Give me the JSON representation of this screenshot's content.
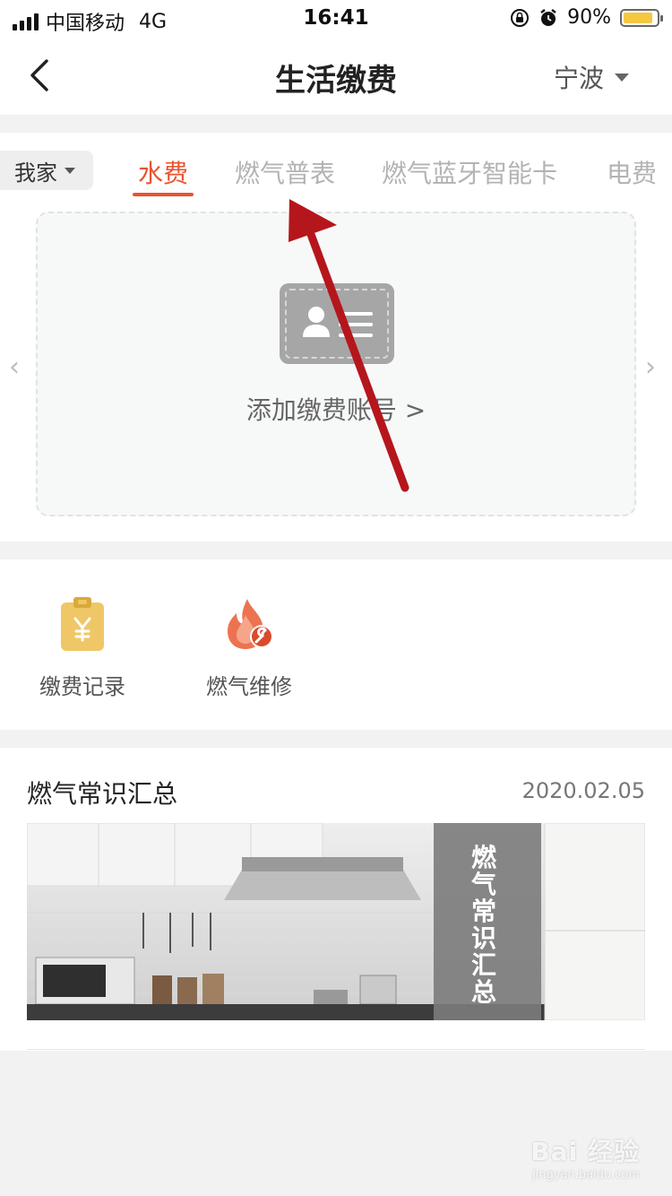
{
  "status_bar": {
    "carrier": "中国移动",
    "network": "4G",
    "time": "16:41",
    "battery": "90%",
    "battery_level": 0.9
  },
  "header": {
    "title": "生活缴费",
    "city": "宁波"
  },
  "group_selector": {
    "label": "我家"
  },
  "tabs": [
    {
      "label": "水费",
      "active": true
    },
    {
      "label": "燃气普表",
      "active": false
    },
    {
      "label": "燃气蓝牙智能卡",
      "active": false
    },
    {
      "label": "电费",
      "active": false
    }
  ],
  "add_account": {
    "label": "添加缴费账号 >"
  },
  "shortcuts": [
    {
      "label": "缴费记录",
      "icon": "payment-record-icon"
    },
    {
      "label": "燃气维修",
      "icon": "gas-repair-icon"
    }
  ],
  "article": {
    "title": "燃气常识汇总",
    "date": "2020.02.05",
    "image_caption": "燃气常识汇总"
  },
  "watermark": {
    "brand": "Bai 经验",
    "url": "jingyan.baidu.com"
  },
  "colors": {
    "accent": "#e8532e",
    "annotation_arrow": "#b5161c",
    "record_icon": "#f0c766",
    "repair_icon": "#ec7350"
  }
}
